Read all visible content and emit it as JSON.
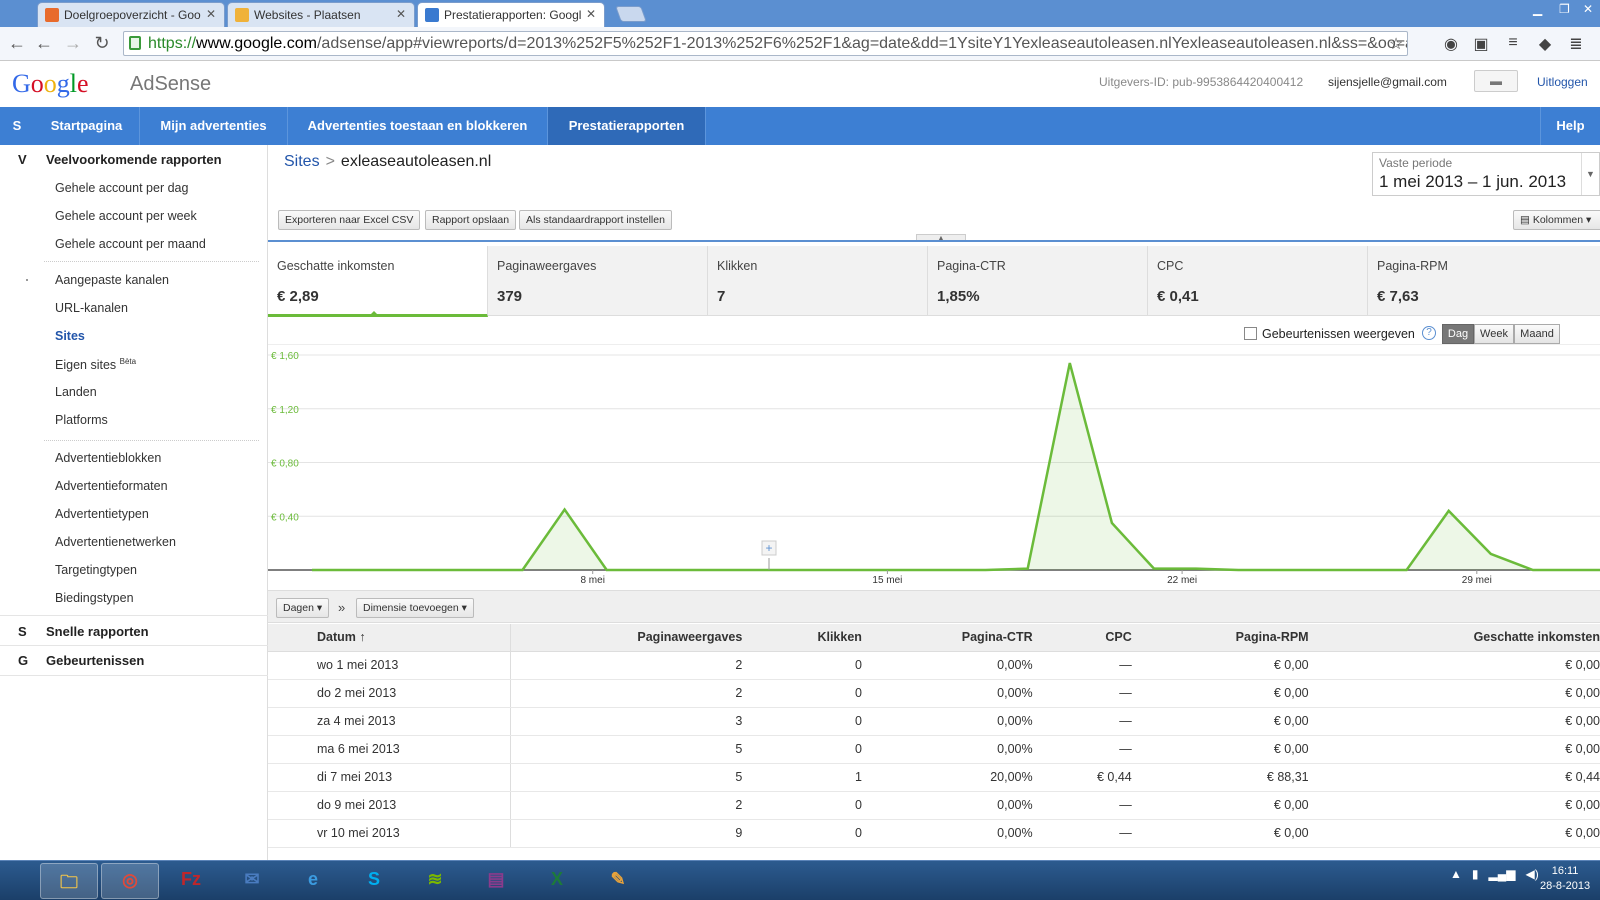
{
  "browser": {
    "tabs": [
      {
        "label": "Doelgroepoverzicht - Goo",
        "favicon_color": "#e86b2c"
      },
      {
        "label": "Websites - Plaatsen",
        "favicon_color": "#f0b23a"
      },
      {
        "label": "Prestatierapporten: Googl",
        "favicon_color": "#3a7ad0"
      }
    ],
    "url_scheme": "https://",
    "url_host": "www.google.com",
    "url_path": "/adsense/app#viewreports/d=2013%252F5%252F1-2013%252F6%252F1&ag=date&dd=1YsiteY1Yexleaseautoleasen.nlYexleaseautoleasen.nl&ss=&oo=asc"
  },
  "header": {
    "logo_text": "Google",
    "product": "AdSense",
    "pub_id": "Uitgevers-ID: pub-9953864420400412",
    "email": "sijensjelle@gmail.com",
    "logout": "Uitloggen"
  },
  "nav": {
    "letter": "S",
    "items": [
      "Startpagina",
      "Mijn advertenties",
      "Advertenties toestaan en blokkeren",
      "Prestatierapporten"
    ],
    "help": "Help"
  },
  "sidebar": {
    "section1": {
      "letter": "V",
      "title": "Veelvoorkomende rapporten"
    },
    "group1": [
      "Gehele account per dag",
      "Gehele account per week",
      "Gehele account per maand"
    ],
    "group2": [
      "Aangepaste kanalen",
      "URL-kanalen",
      "Sites",
      "Eigen sites",
      "Landen",
      "Platforms"
    ],
    "beta": "Bèta",
    "group3": [
      "Advertentieblokken",
      "Advertentieformaten",
      "Advertentietypen",
      "Advertentienetwerken",
      "Targetingtypen",
      "Biedingstypen"
    ],
    "section2": {
      "letter": "S",
      "title": "Snelle rapporten"
    },
    "section3": {
      "letter": "G",
      "title": "Gebeurtenissen"
    }
  },
  "report": {
    "breadcrumb_link": "Sites",
    "breadcrumb_sep": ">",
    "breadcrumb_current": "exleaseautoleasen.nl",
    "period_label": "Vaste periode",
    "period_value": "1 mei 2013 – 1 jun. 2013",
    "buttons": {
      "export": "Exporteren naar Excel CSV",
      "save": "Rapport opslaan",
      "default": "Als standaardrapport instellen",
      "columns": "Kolommen"
    },
    "metrics": [
      {
        "label": "Geschatte inkomsten",
        "value": "€ 2,89"
      },
      {
        "label": "Paginaweergaves",
        "value": "379"
      },
      {
        "label": "Klikken",
        "value": "7"
      },
      {
        "label": "Pagina-CTR",
        "value": "1,85%"
      },
      {
        "label": "CPC",
        "value": "€ 0,41"
      },
      {
        "label": "Pagina-RPM",
        "value": "€ 7,63"
      }
    ],
    "events_label": "Gebeurtenissen weergeven",
    "granularity": [
      "Dag",
      "Week",
      "Maand"
    ],
    "dimension_dd": "Dagen",
    "add_dimension": "Dimensie toevoegen",
    "raquo": "»"
  },
  "chart_data": {
    "type": "area",
    "series": [
      {
        "values": [
          0,
          0,
          0,
          0,
          0,
          0,
          0.45,
          0,
          0,
          0,
          0,
          0,
          0,
          0,
          0,
          0,
          0,
          0.01,
          1.54,
          0.35,
          0.01,
          0.01,
          0,
          0,
          0,
          0,
          0,
          0.44,
          0.12,
          0,
          0,
          0
        ]
      }
    ],
    "x_tick_labels": [
      "8 mei",
      "15 mei",
      "22 mei",
      "29 mei"
    ],
    "y_tick_labels": [
      "€ 1,60",
      "€ 1,20",
      "€ 0,80",
      "€ 0,40"
    ],
    "ylim": [
      0,
      1.6
    ],
    "color": "#6bbb3a"
  },
  "table": {
    "headers": [
      "Datum",
      "Paginaweergaves",
      "Klikken",
      "Pagina-CTR",
      "CPC",
      "Pagina-RPM",
      "Geschatte inkomsten"
    ],
    "rows": [
      [
        "wo 1 mei 2013",
        "2",
        "0",
        "0,00%",
        "—",
        "€ 0,00",
        "€ 0,00"
      ],
      [
        "do 2 mei 2013",
        "2",
        "0",
        "0,00%",
        "—",
        "€ 0,00",
        "€ 0,00"
      ],
      [
        "za 4 mei 2013",
        "3",
        "0",
        "0,00%",
        "—",
        "€ 0,00",
        "€ 0,00"
      ],
      [
        "ma 6 mei 2013",
        "5",
        "0",
        "0,00%",
        "—",
        "€ 0,00",
        "€ 0,00"
      ],
      [
        "di 7 mei 2013",
        "5",
        "1",
        "20,00%",
        "€ 0,44",
        "€ 88,31",
        "€ 0,44"
      ],
      [
        "do 9 mei 2013",
        "2",
        "0",
        "0,00%",
        "—",
        "€ 0,00",
        "€ 0,00"
      ],
      [
        "vr 10 mei 2013",
        "9",
        "0",
        "0,00%",
        "—",
        "€ 0,00",
        "€ 0,00"
      ]
    ]
  },
  "taskbar": {
    "apps": [
      "explorer-icon",
      "chrome-icon",
      "filezilla-icon",
      "thunderbird-icon",
      "ie-icon",
      "skype-icon",
      "spotify-icon",
      "winrar-icon",
      "excel-icon",
      "paint-icon"
    ],
    "time": "16:11",
    "date": "28-8-2013"
  }
}
